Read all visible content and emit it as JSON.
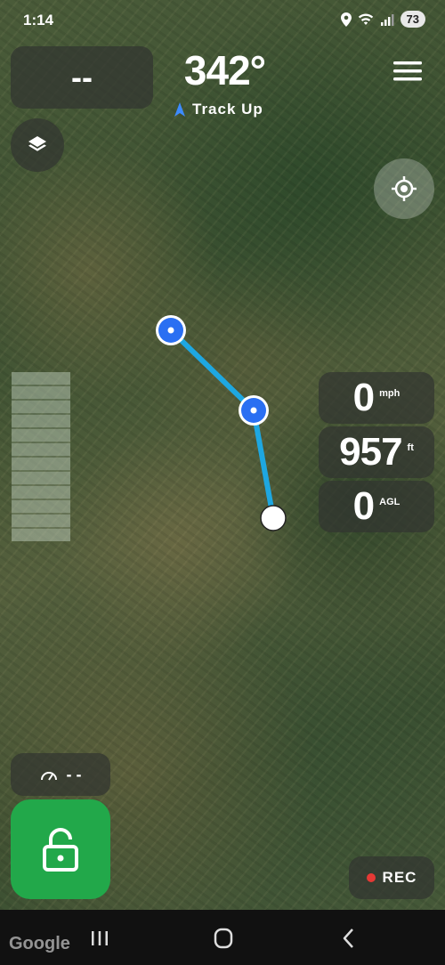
{
  "status": {
    "time": "1:14",
    "battery": "73"
  },
  "top": {
    "speed_value": "--",
    "heading": "342°",
    "orientation_mode": "Track Up"
  },
  "readouts": [
    {
      "value": "0",
      "unit": "mph"
    },
    {
      "value": "957",
      "unit": "ft"
    },
    {
      "value": "0",
      "unit": "AGL"
    }
  ],
  "bottom": {
    "gauge_value": "- -",
    "rec_label": "REC",
    "map_attribution": "Google"
  },
  "colors": {
    "route": "#1ea7e1",
    "waypoint": "#2a6ff2",
    "lock_button": "#22a84a",
    "rec_dot": "#e53935"
  },
  "icons": [
    "wifi-icon",
    "signal-icon",
    "location-icon",
    "menu-icon",
    "layers-icon",
    "crosshair-icon",
    "speedometer-icon",
    "lock-icon",
    "nav-recents-icon",
    "nav-home-icon",
    "nav-back-icon"
  ]
}
